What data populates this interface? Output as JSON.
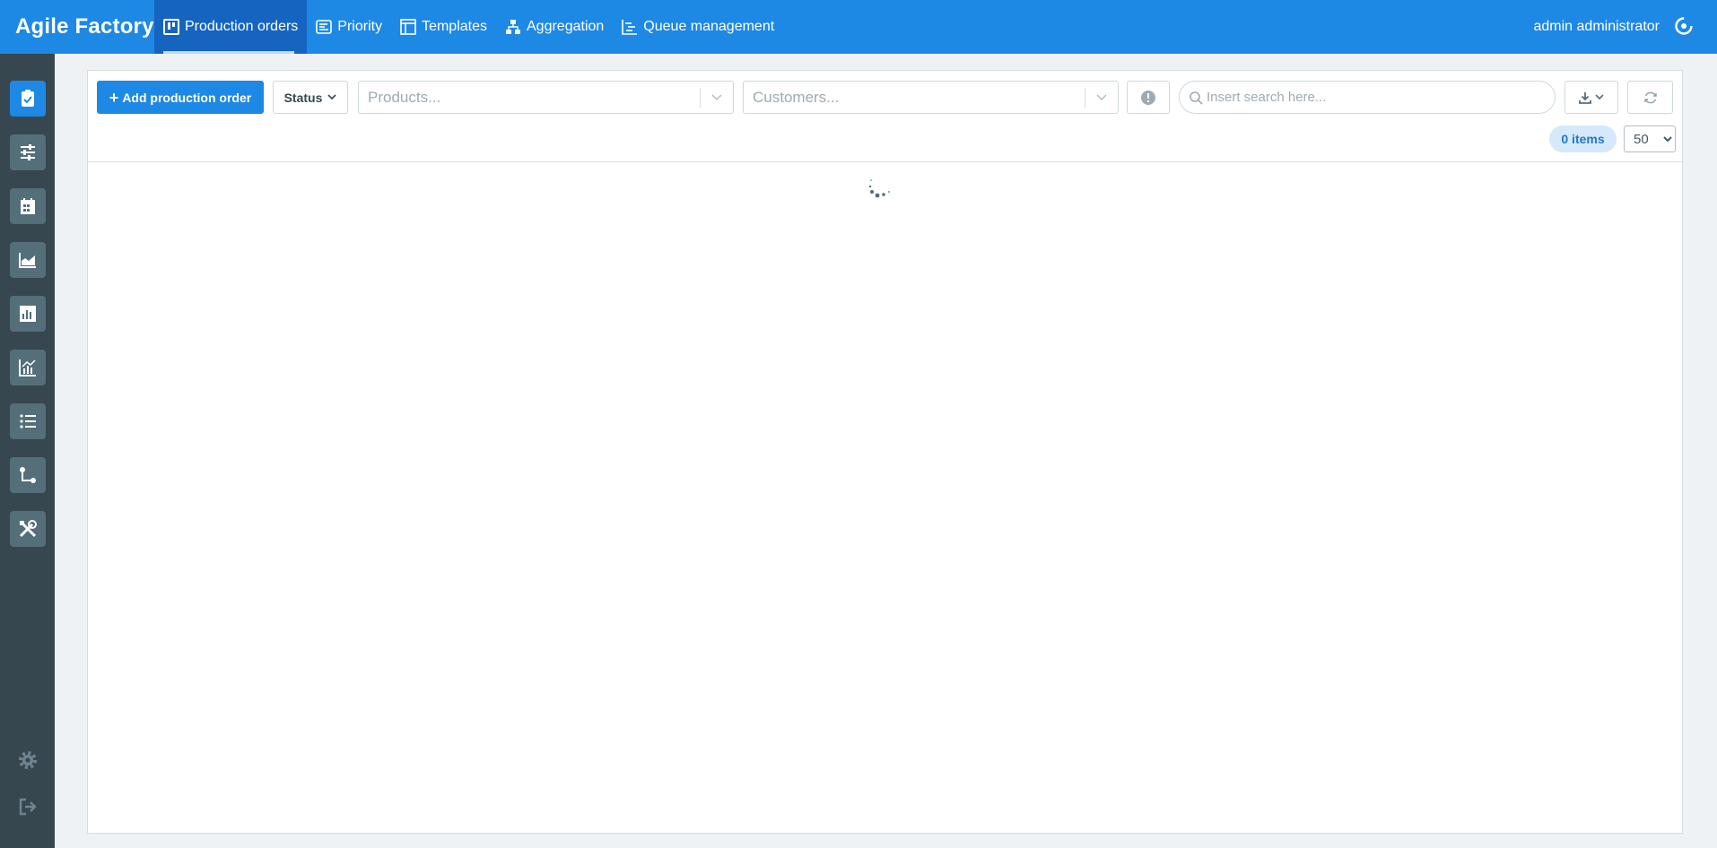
{
  "app": {
    "brand": "Agile Factory"
  },
  "nav": [
    {
      "label": "Production orders",
      "icon": "board-icon",
      "active": true
    },
    {
      "label": "Priority",
      "icon": "priority-icon"
    },
    {
      "label": "Templates",
      "icon": "template-icon"
    },
    {
      "label": "Aggregation",
      "icon": "aggregation-icon"
    },
    {
      "label": "Queue management",
      "icon": "queue-icon"
    }
  ],
  "user": {
    "name": "admin administrator",
    "icon": "user-menu-icon"
  },
  "sidebar": [
    {
      "icon": "clipboard-check-icon",
      "active": true
    },
    {
      "icon": "sliders-icon"
    },
    {
      "icon": "calendar-icon"
    },
    {
      "icon": "area-chart-icon"
    },
    {
      "icon": "bar-chart-icon"
    },
    {
      "icon": "line-chart-icon"
    },
    {
      "icon": "list-icon"
    },
    {
      "icon": "flow-icon"
    },
    {
      "icon": "tools-icon"
    },
    {
      "icon": "settings-gear-icon"
    },
    {
      "icon": "logout-icon"
    }
  ],
  "toolbar": {
    "add_label": "Add production order",
    "status_label": "Status",
    "products_placeholder": "Products...",
    "customers_placeholder": "Customers...",
    "search_placeholder": "Insert search here...",
    "items_badge": "0 items",
    "page_size": "50",
    "page_size_options": [
      "50"
    ]
  },
  "colors": {
    "primary": "#1e88e5",
    "primary_dark": "#1565c0",
    "sidebar": "#37474f",
    "sidebar_button": "#546e7a"
  },
  "content": {
    "state": "loading",
    "spinner_icon": "loading-spinner-icon"
  }
}
